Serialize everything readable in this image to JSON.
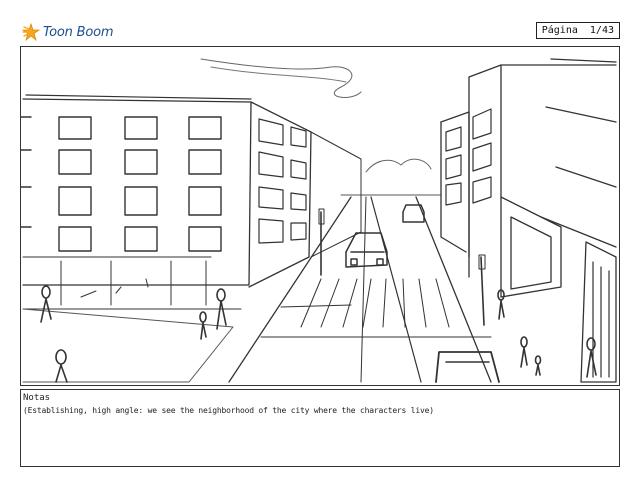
{
  "header": {
    "logo_text": "Toon Boom",
    "page_label": "Página",
    "page_number": "1/43"
  },
  "panel": {
    "image": "city-street-storyboard-sketch"
  },
  "notes": {
    "title": "Notas",
    "text": "(Establishing, high angle: we see the neighborhood of the city where the characters live)"
  },
  "colors": {
    "logo_blue": "#1f4f92",
    "logo_orange": "#f5a623",
    "sketch_line": "#333333"
  }
}
